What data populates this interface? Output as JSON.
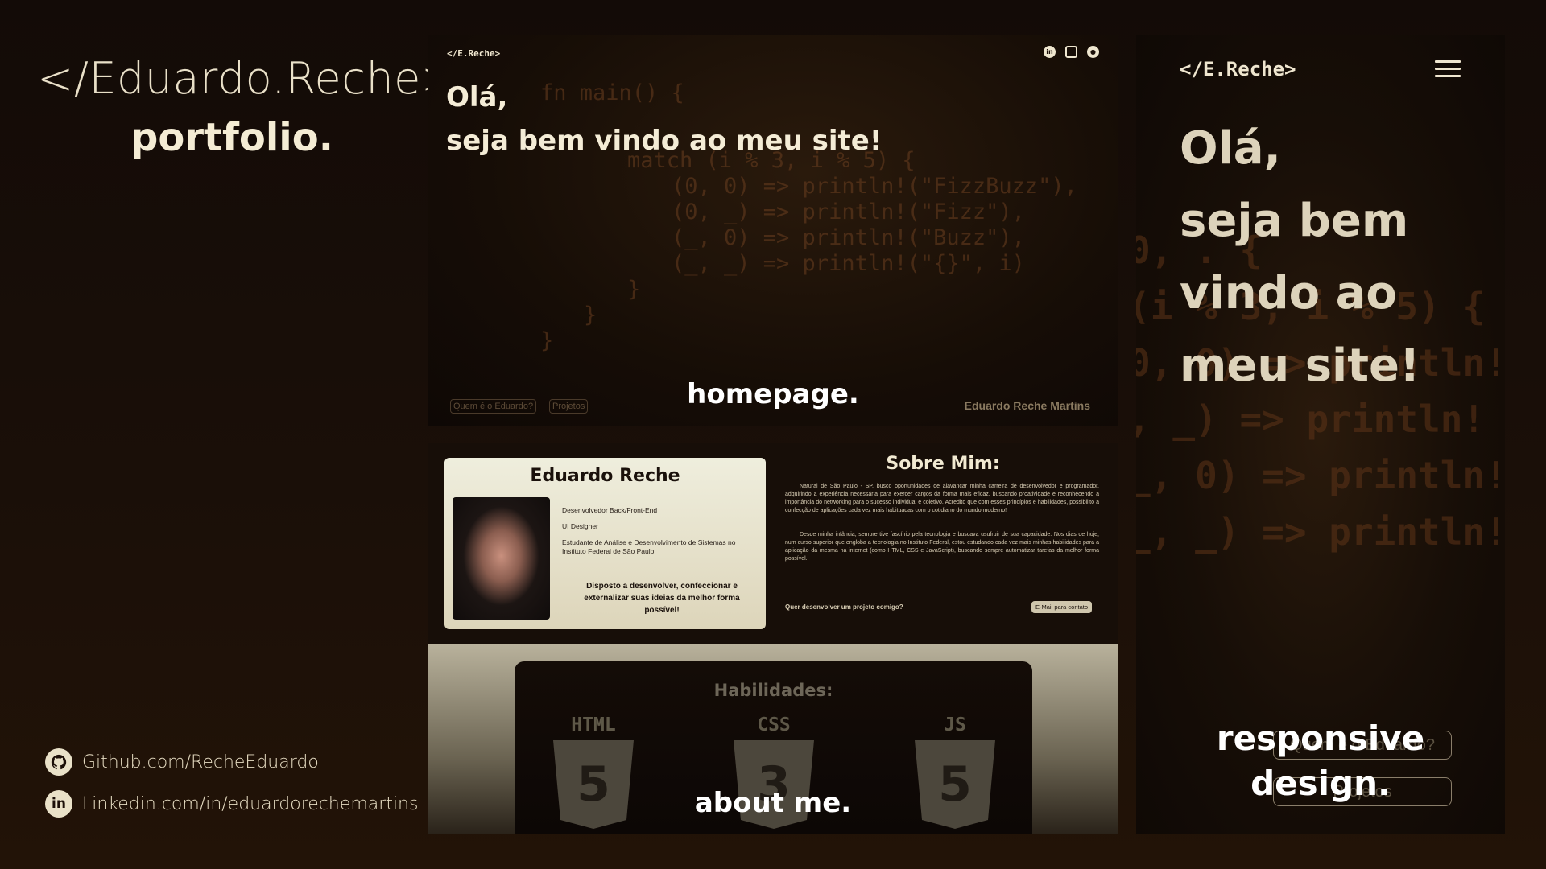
{
  "brand": {
    "title": "</Eduardo.Reche>",
    "subtitle": "portfolio."
  },
  "links": {
    "github": "Github.com/RecheEduardo",
    "linkedin": "Linkedin.com/in/eduardorechemartins"
  },
  "homepage": {
    "logo": "</E.Reche>",
    "greeting_line1": "Olá,",
    "greeting_line2": "seja bem vindo ao meu site!",
    "code_lines": [
      "fn main() {",
      "match (i % 3, i % 5) {",
      "(0, 0) => println!(\"FizzBuzz\"),",
      "(0, _) => println!(\"Fizz\"),",
      "(_, 0) => println!(\"Buzz\"),",
      "(_, _) => println!(\"{}\", i)",
      "}",
      "}",
      "}"
    ],
    "nav_links": [
      "Quem é o Eduardo?",
      "Projetos"
    ],
    "author": "Eduardo Reche Martins",
    "caption": "homepage."
  },
  "about": {
    "name": "Eduardo Reche",
    "roles": [
      "Desenvolvedor Back/Front-End",
      "UI Designer",
      "Estudante de Análise e Desenvolvimento de Sistemas no Instituto Federal de São Paulo"
    ],
    "tagline": "Disposto a desenvolver, confeccionar e externalizar suas ideias da melhor forma possível!",
    "title": "Sobre Mim:",
    "bio_1": "Natural de São Paulo - SP, busco oportunidades de alavancar minha carreira de desenvolvedor e programador, adquirindo a experiência necessária para exercer cargos da forma mais eficaz, buscando proatividade e reconhecendo a importância do networking para o sucesso individual e coletivo. Acredito que com esses princípios e habilidades, possibilito a confecção de aplicações cada vez mais habituadas com o cotidiano do mundo moderno!",
    "bio_2": "Desde minha infância, sempre tive fascínio pela tecnologia e buscava usufruir de sua capacidade. Nos dias de hoje, num curso superior que engloba a tecnologia no Instituto Federal, estou estudando cada vez mais minhas habilidades para a aplicação da mesma na internet (como HTML, CSS e JavaScript), buscando sempre automatizar tarefas da melhor forma possível.",
    "cta": "Quer desenvolver um projeto comigo?",
    "email_button": "E-Mail para contato",
    "skills_title": "Habilidades:",
    "skills": [
      "HTML",
      "CSS",
      "JS"
    ],
    "caption": "about me."
  },
  "mobile": {
    "logo": "</E.Reche>",
    "greeting": [
      "Olá,",
      "seja bem",
      "vindo ao",
      "meu site!"
    ],
    "code_lines": [
      "0, . {",
      "(i % 3, i % 5) {",
      "0, 0) => println!",
      ", _) => println!",
      "_, 0) => println!",
      "_, _) => println!"
    ],
    "button_1": "Quem é o Eduardo?",
    "button_2": "Projetos",
    "caption_line1": "responsive",
    "caption_line2": "design."
  },
  "colors": {
    "background": "#1a0f08",
    "text_cream": "#efe6cf",
    "code_brown": "#6b3f20",
    "card_cream": "#efeedd"
  },
  "icons": [
    "github-icon",
    "linkedin-icon",
    "instagram-icon",
    "menu-icon"
  ]
}
